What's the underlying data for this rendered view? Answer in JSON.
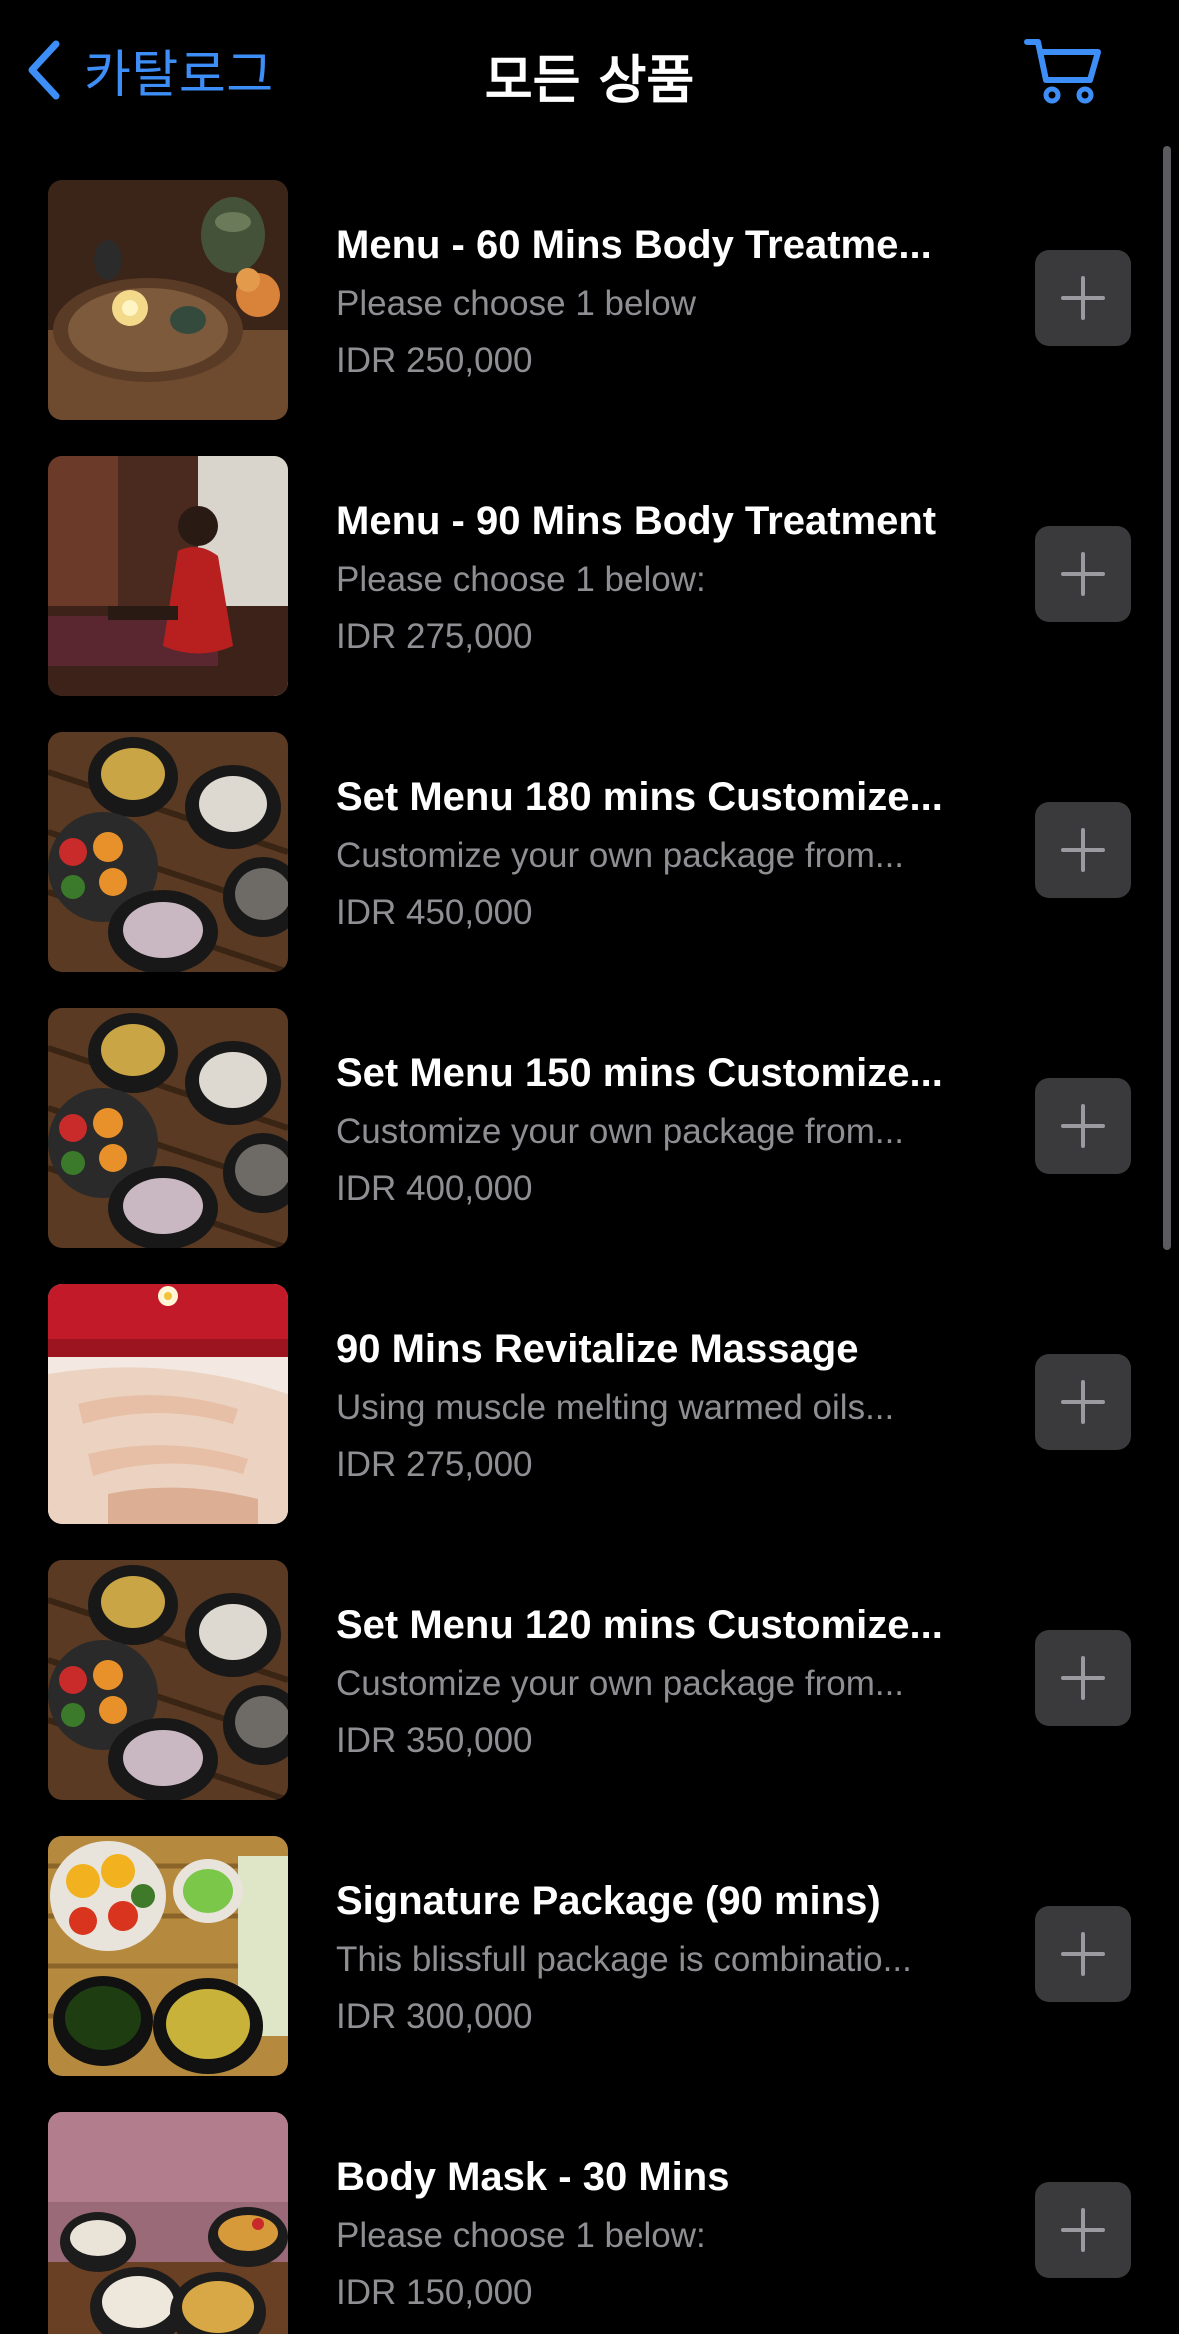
{
  "nav": {
    "back_label": "카탈로그",
    "title": "모든 상품",
    "back_icon": "chevron-left-icon",
    "cart_icon": "cart-icon"
  },
  "colors": {
    "accent": "#3d8ef7",
    "background": "#000000",
    "secondary_text": "#8e8e93",
    "button_bg": "#3a3a3c"
  },
  "products": [
    {
      "title": "Menu - 60 Mins Body Treatme...",
      "desc": "Please choose 1 below",
      "price": "IDR 250,000",
      "image": "candle-spa-tray"
    },
    {
      "title": "Menu - 90 Mins Body Treatment",
      "desc": "Please choose 1 below:",
      "price": "IDR 275,000",
      "image": "woman-treatment-room"
    },
    {
      "title": "Set Menu 180 mins Customize...",
      "desc": "Customize your own package from...",
      "price": "IDR 450,000",
      "image": "spa-bowls-tray"
    },
    {
      "title": "Set Menu 150 mins Customize...",
      "desc": "Customize your own package from...",
      "price": "IDR 400,000",
      "image": "spa-bowls-tray"
    },
    {
      "title": "90 Mins Revitalize Massage",
      "desc": "Using muscle melting warmed oils...",
      "price": "IDR 275,000",
      "image": "massage-hands"
    },
    {
      "title": "Set Menu 120 mins Customize...",
      "desc": "Customize your own package from...",
      "price": "IDR 350,000",
      "image": "spa-bowls-tray"
    },
    {
      "title": "Signature Package (90 mins)",
      "desc": "This blissfull package is combinatio...",
      "price": "IDR 300,000",
      "image": "signature-citrus-bowls"
    },
    {
      "title": "Body Mask - 30 Mins",
      "desc": "Please choose 1 below:",
      "price": "IDR 150,000",
      "image": "body-mask-bowls"
    }
  ],
  "add_icon": "plus-icon"
}
